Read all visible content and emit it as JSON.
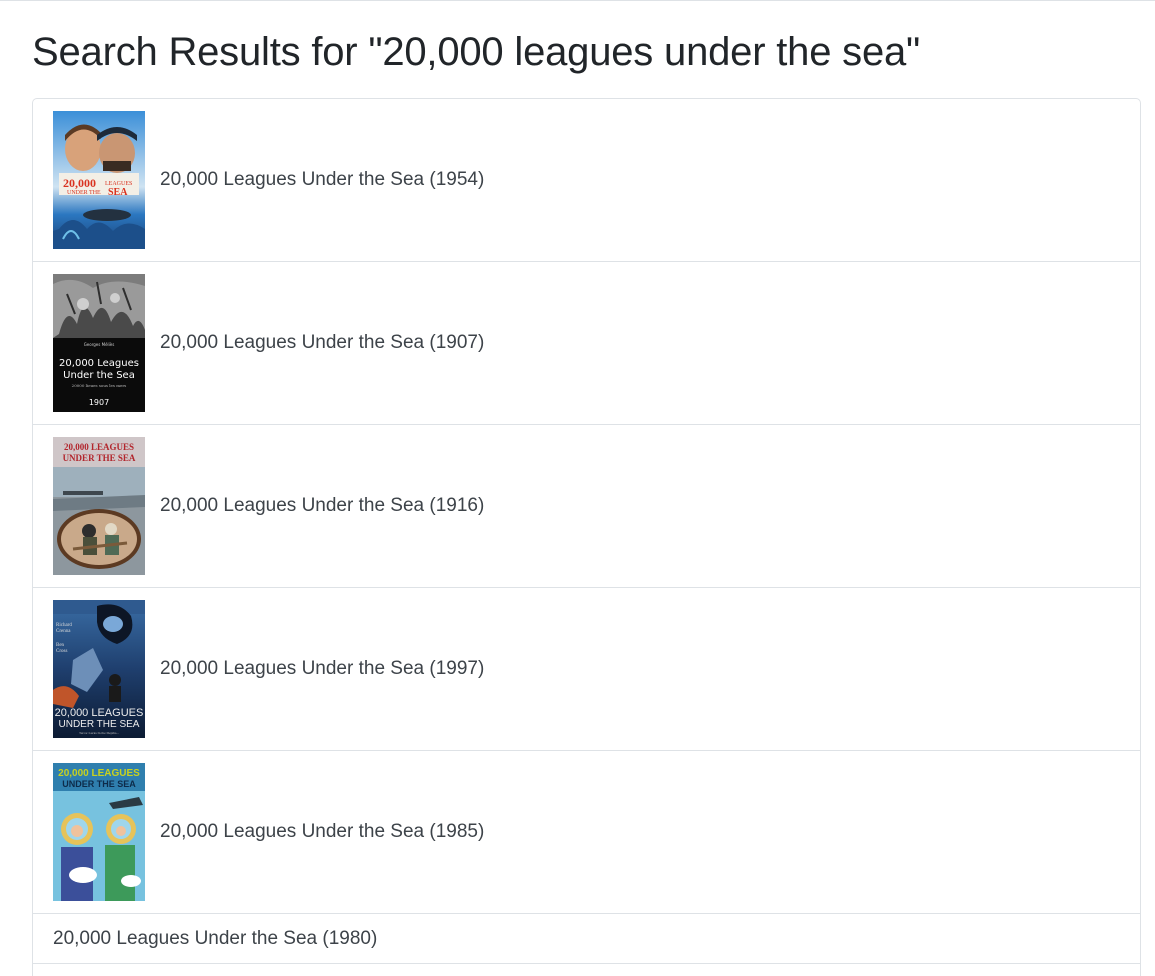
{
  "page": {
    "title": "Search Results for \"20,000 leagues under the sea\""
  },
  "results": [
    {
      "label": "20,000 Leagues Under the Sea (1954)",
      "poster": {
        "icon": "movie-poster-1954",
        "text": [
          "20,000 LEAGUES",
          "UNDER THE SEA"
        ],
        "colors": {
          "bg": "#1f6fb3",
          "accent": "#d9321f"
        }
      }
    },
    {
      "label": "20,000 Leagues Under the Sea (1907)",
      "poster": {
        "icon": "movie-poster-1907",
        "text": [
          "Georges Méliès",
          "20,000 Leagues",
          "Under the Sea",
          "20000 lieues sous les mers",
          "1907"
        ],
        "colors": {
          "bg": "#0b0b0b",
          "accent": "#ffffff"
        }
      }
    },
    {
      "label": "20,000 Leagues Under the Sea (1916)",
      "poster": {
        "icon": "movie-poster-1916",
        "text": [
          "20,000 LEAGUES",
          "UNDER THE SEA"
        ],
        "colors": {
          "bg": "#7d8a93",
          "accent": "#b2262d"
        }
      }
    },
    {
      "label": "20,000 Leagues Under the Sea (1997)",
      "poster": {
        "icon": "movie-poster-1997",
        "text": [
          "Richard Crenna",
          "Ben Cross",
          "20,000 LEAGUES",
          "UNDER THE SEA",
          "Terror Lurks In the Depths..."
        ],
        "colors": {
          "bg": "#1b3b6b",
          "accent": "#e0e0e0"
        }
      }
    },
    {
      "label": "20,000 Leagues Under the Sea (1985)",
      "poster": {
        "icon": "movie-poster-1985",
        "text": [
          "20,000 LEAGUES",
          "UNDER THE SEA"
        ],
        "colors": {
          "bg": "#6ab7d6",
          "accent": "#c9d21f"
        }
      }
    },
    {
      "label": "20,000 Leagues Under the Sea (1980)",
      "poster": null
    }
  ]
}
